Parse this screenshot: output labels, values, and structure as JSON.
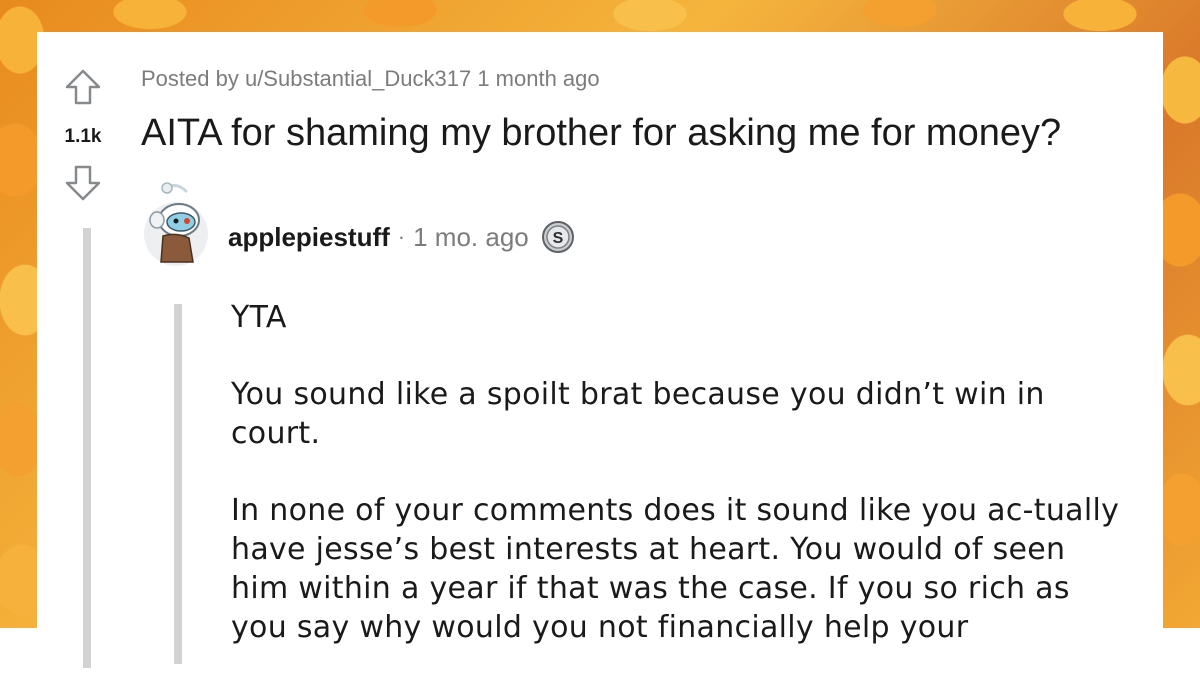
{
  "post": {
    "score": "1.1k",
    "meta": "Posted by u/Substantial_Duck317 1 month ago",
    "title": "AITA for shaming my brother for asking me for money?"
  },
  "comment": {
    "username": "applepiestuff",
    "separator": "·",
    "time_ago": "1 mo. ago",
    "badge_icon": "silver-award-icon",
    "paragraphs": [
      "YTA",
      "You sound like a spoilt brat because you didn’t win in court.",
      "In none of your comments does it sound like you ac-tually have jesse’s best interests at heart. You would of seen him within a year if that was the case. If you so rich as you say why would you not financially help your"
    ]
  },
  "colors": {
    "text": "#1a1a1b",
    "muted": "#7c7c7c",
    "thread_line": "#d2d2d2",
    "background": "#f5b53d"
  }
}
